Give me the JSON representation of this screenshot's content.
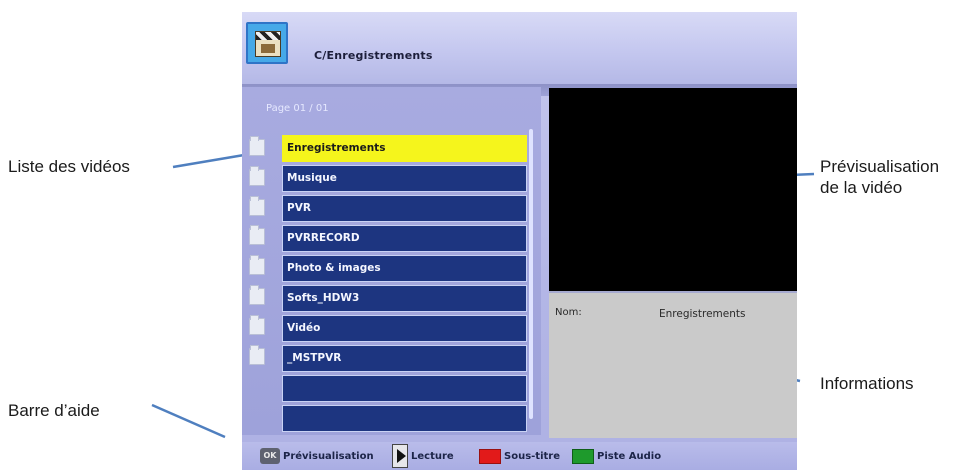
{
  "annotations": {
    "video_list": "Liste des vidéos",
    "help_bar": "Barre d’aide",
    "preview_line1": "Prévisualisation",
    "preview_line2": "de la vidéo",
    "information": "Informations"
  },
  "screen": {
    "path": "C/Enregistrements",
    "page": "Page  01 / 01",
    "items": [
      {
        "label": "Enregistrements",
        "selected": true
      },
      {
        "label": "Musique"
      },
      {
        "label": "PVR"
      },
      {
        "label": "PVRRECORD"
      },
      {
        "label": "Photo & images"
      },
      {
        "label": "Softs_HDW3"
      },
      {
        "label": "Vidéo"
      },
      {
        "label": "_MSTPVR"
      },
      {
        "label": ""
      },
      {
        "label": ""
      }
    ],
    "info": {
      "key": "Nom:",
      "value": "Enregistrements"
    },
    "help": {
      "ok_key": "OK",
      "preview_label": "Prévisualisation",
      "play_label": "Lecture",
      "subtitle_label": "Sous-titre",
      "audio_label": "Piste Audio"
    },
    "colors": {
      "selected_row": "#f5f51c",
      "row": "#1d3580",
      "red_key": "#e21a1a",
      "green_key": "#1e9a2c",
      "callout_line": "#4f7fbf"
    }
  }
}
